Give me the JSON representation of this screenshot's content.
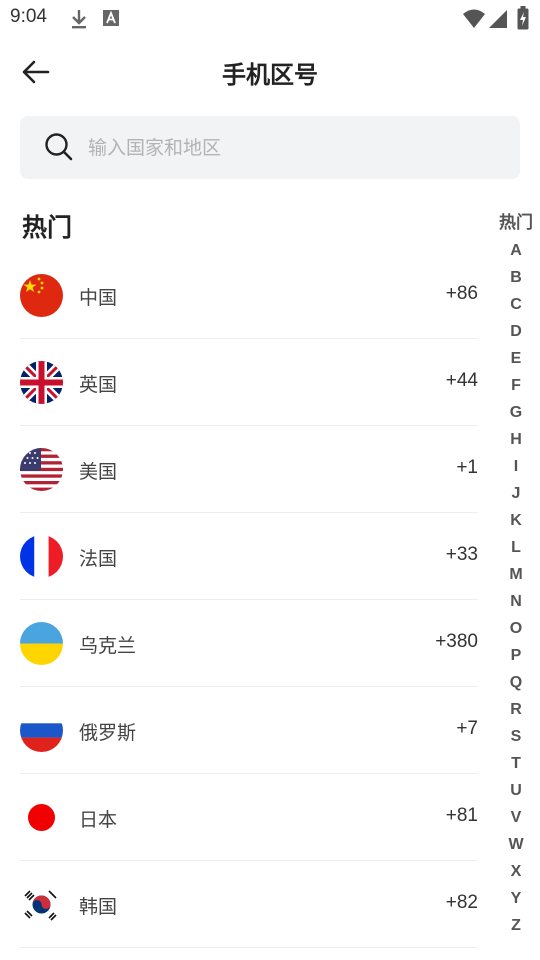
{
  "status_bar": {
    "time": "9:04",
    "icons": [
      "download-icon",
      "a-notification-icon",
      "wifi-icon",
      "signal-icon",
      "battery-charging-icon"
    ]
  },
  "header": {
    "title": "手机区号",
    "back_icon": "arrow-left-icon"
  },
  "search": {
    "placeholder": "输入国家和地区",
    "icon": "search-icon"
  },
  "section_title": "热门",
  "countries": [
    {
      "name": "中国",
      "code": "+86",
      "flag": "china-flag-icon"
    },
    {
      "name": "英国",
      "code": "+44",
      "flag": "uk-flag-icon"
    },
    {
      "name": "美国",
      "code": "+1",
      "flag": "usa-flag-icon"
    },
    {
      "name": "法国",
      "code": "+33",
      "flag": "france-flag-icon"
    },
    {
      "name": "乌克兰",
      "code": "+380",
      "flag": "ukraine-flag-icon"
    },
    {
      "name": "俄罗斯",
      "code": "+7",
      "flag": "russia-flag-icon"
    },
    {
      "name": "日本",
      "code": "+81",
      "flag": "japan-flag-icon"
    },
    {
      "name": "韩国",
      "code": "+82",
      "flag": "korea-flag-icon"
    }
  ],
  "index_bar": [
    "热门",
    "A",
    "B",
    "C",
    "D",
    "E",
    "F",
    "G",
    "H",
    "I",
    "J",
    "K",
    "L",
    "M",
    "N",
    "O",
    "P",
    "Q",
    "R",
    "S",
    "T",
    "U",
    "V",
    "W",
    "X",
    "Y",
    "Z"
  ],
  "colors": {
    "title": "#222222",
    "search_bg": "#f2f3f5",
    "placeholder": "#b3b3b3",
    "divider": "#eeeeee"
  }
}
